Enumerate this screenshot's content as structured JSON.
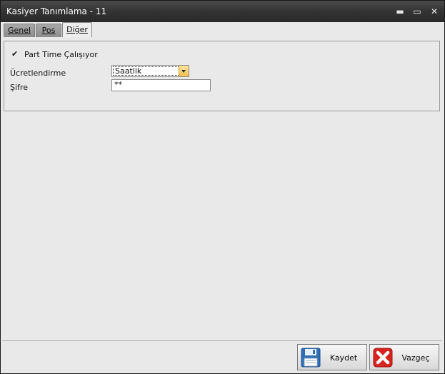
{
  "window": {
    "title": "Kasiyer Tanımlama - 11"
  },
  "window_controls": {
    "minimize": "▬",
    "maximize": "▭",
    "close": "✕"
  },
  "tabs": [
    {
      "label": "Genel",
      "active": false
    },
    {
      "label": "Pos",
      "active": false
    },
    {
      "label": "Diğer",
      "active": true
    }
  ],
  "form": {
    "part_time": {
      "label": "Part Time Çalışıyor",
      "checked": true,
      "check_glyph": "✔"
    },
    "ucretlendirme": {
      "label": "Ücretlendirme",
      "value": "Saatlik"
    },
    "sifre": {
      "label": "Şifre",
      "value": "**"
    }
  },
  "buttons": {
    "save": {
      "label": "Kaydet",
      "icon": "floppy-disk-icon"
    },
    "cancel": {
      "label": "Vazgeç",
      "icon": "red-x-icon"
    }
  },
  "colors": {
    "titlebar": "#333333",
    "body": "#e9e9e9",
    "combo_button": "#f3c04d",
    "save_icon": "#2f6db7",
    "cancel_icon": "#d9231f"
  }
}
